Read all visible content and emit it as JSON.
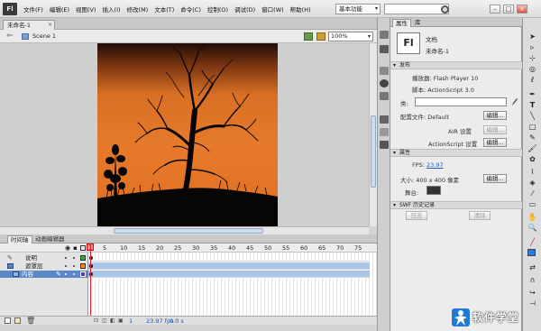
{
  "menubar": {
    "logo": "Fl",
    "items": [
      "文件(F)",
      "编辑(E)",
      "视图(V)",
      "插入(I)",
      "修改(M)",
      "文本(T)",
      "命令(C)",
      "控制(O)",
      "调试(D)",
      "窗口(W)",
      "帮助(H)"
    ],
    "workspace": "基本功能",
    "window_buttons": [
      "–",
      "□",
      "×"
    ]
  },
  "doc_tab": {
    "title": "未命名-1",
    "close": "×"
  },
  "editbar": {
    "back": "⇐",
    "scene": "Scene 1",
    "zoom": "100%"
  },
  "timeline": {
    "tabs": [
      "时间轴",
      "动画编辑器"
    ],
    "frame_numbers": [
      "1",
      "5",
      "10",
      "15",
      "20",
      "25",
      "30",
      "35",
      "40",
      "45",
      "50",
      "55",
      "60",
      "65",
      "70",
      "75"
    ],
    "layers": [
      {
        "name": "说明",
        "color": "#33aa33"
      },
      {
        "name": "遮罩层",
        "color": "#ff8800"
      },
      {
        "name": "内容",
        "color": "#6b2fc6"
      }
    ],
    "footer": {
      "frame": "1",
      "fps": "23.97 fps",
      "time": "0.0 s"
    }
  },
  "properties": {
    "tabs": [
      "属性",
      "库"
    ],
    "badge": "Fl",
    "doc_type": "文档",
    "doc_name": "未命名-1",
    "publish_section": "发布",
    "player_label": "播放器: Flash Player 10",
    "script_label": "脚本: ActionScript 3.0",
    "class_label": "类:",
    "profile_label": "配置文件: Default",
    "edit_button": "编辑...",
    "air_label": "AIR 设置",
    "as_label": "ActionScript 设置",
    "props_section": "属性",
    "fps_label": "FPS:",
    "fps_value": "23.97",
    "size_label": "大小: 400 x 400 像素",
    "stage_label": "舞台:",
    "stage_color": "#333333",
    "history_section": "SWF 历史记录",
    "log_button": "日志",
    "clear_button": "清除"
  },
  "watermark": {
    "text": "软件学堂"
  }
}
